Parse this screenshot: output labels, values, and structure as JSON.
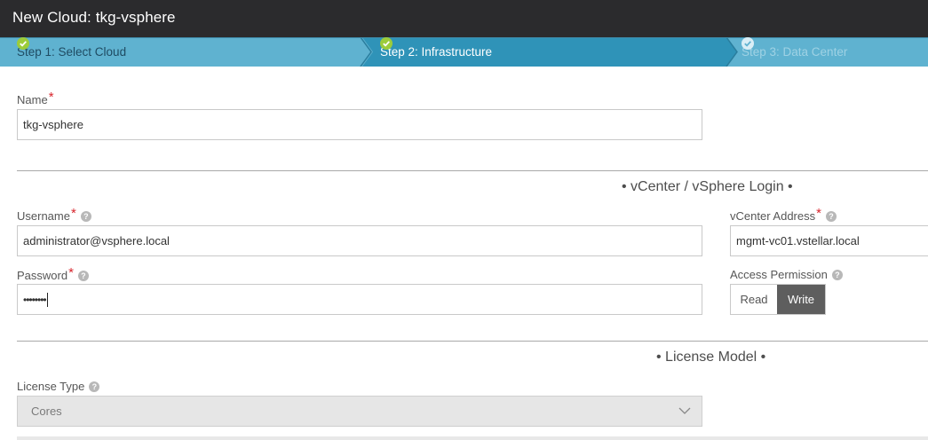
{
  "window": {
    "title": "New Cloud: tkg-vsphere"
  },
  "wizard": {
    "steps": [
      {
        "label": "Step 1: Select Cloud",
        "state": "completed"
      },
      {
        "label": "Step 2: Infrastructure",
        "state": "active"
      },
      {
        "label": "Step 3: Data Center",
        "state": "pending"
      }
    ],
    "colors": {
      "inactive": "#5fb2d0",
      "active": "#2f93b8",
      "text_pending": "#9fd2e4"
    }
  },
  "form": {
    "name": {
      "label": "Name",
      "required_mark": "*",
      "value": "tkg-vsphere"
    },
    "vcenter_section": {
      "title": "• vCenter / vSphere Login •"
    },
    "username": {
      "label": "Username",
      "required_mark": "*",
      "value": "administrator@vsphere.local"
    },
    "vcenter_address": {
      "label": "vCenter Address",
      "required_mark": "*",
      "value": "mgmt-vc01.vstellar.local"
    },
    "password": {
      "label": "Password",
      "required_mark": "*",
      "value": "••••••••"
    },
    "access_permission": {
      "label": "Access Permission",
      "options": [
        "Read",
        "Write"
      ],
      "selected": "Write"
    },
    "license_section": {
      "title": "• License Model •"
    },
    "license_type": {
      "label": "License Type",
      "value": "Cores"
    }
  }
}
